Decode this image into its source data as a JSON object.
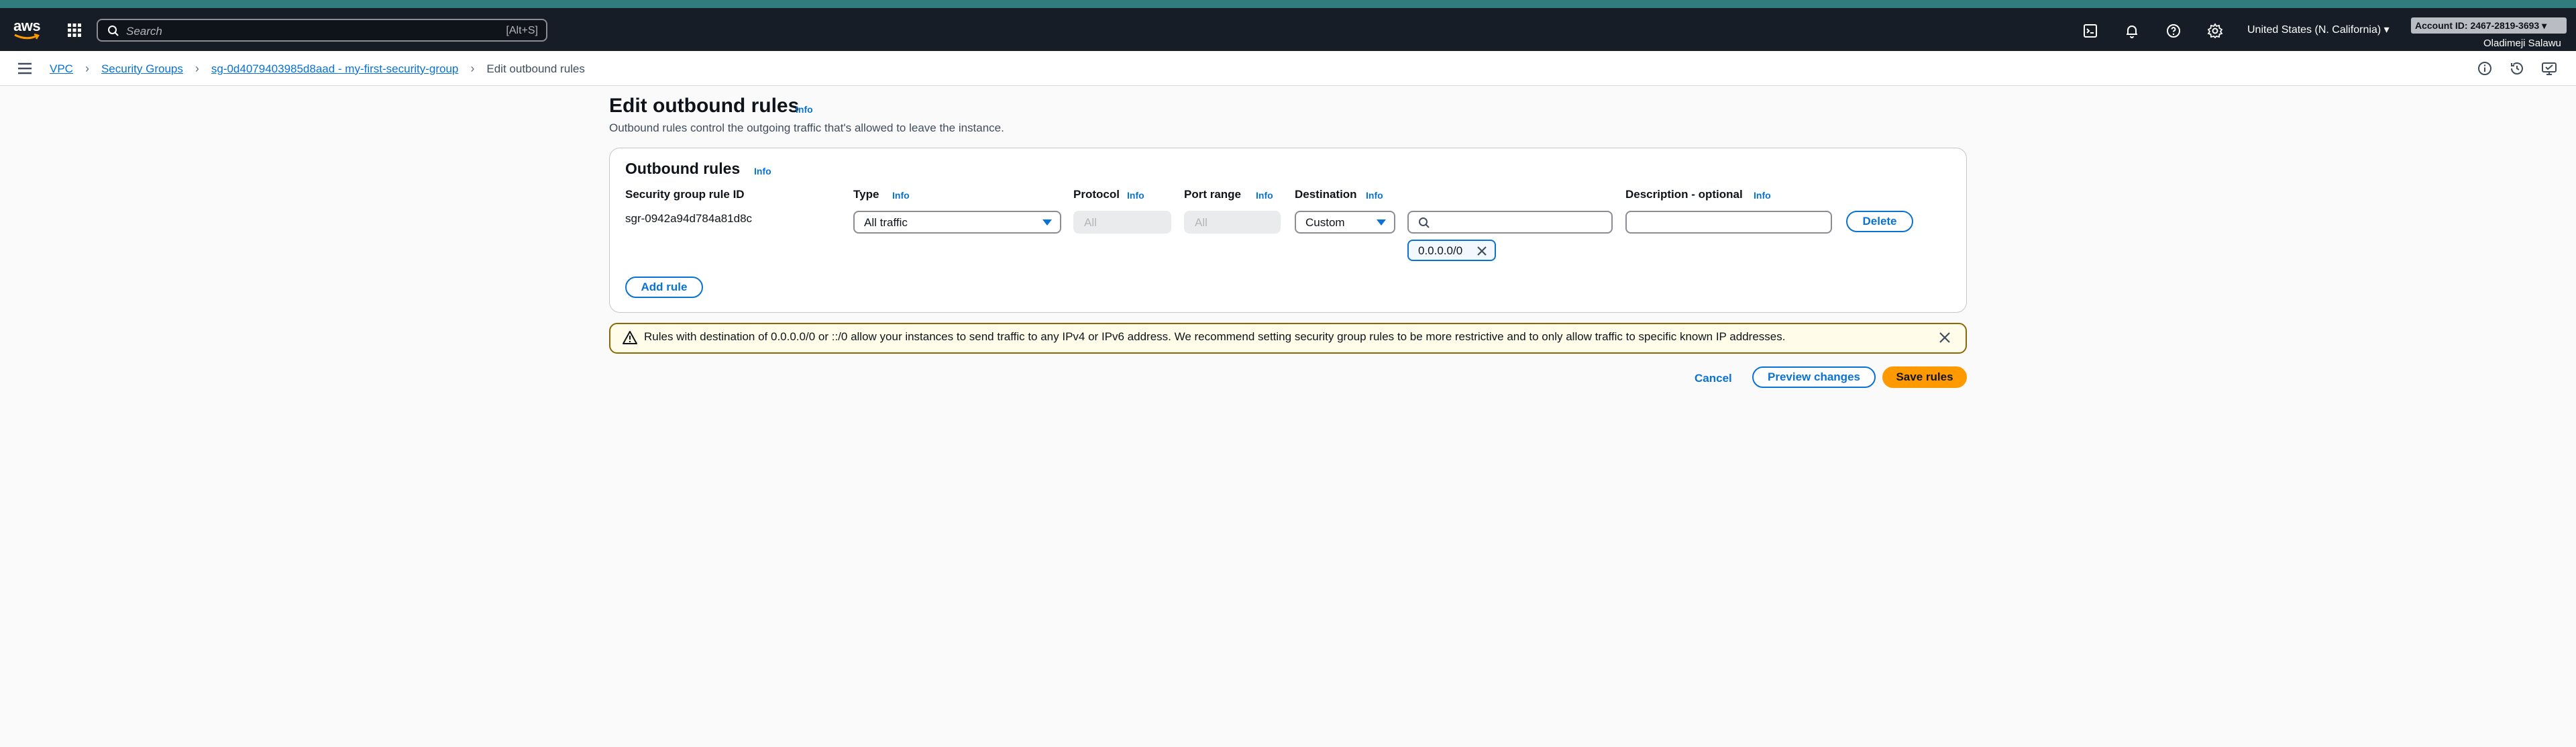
{
  "nav": {
    "search_placeholder": "Search",
    "search_shortcut": "[Alt+S]",
    "region": "United States (N. California) ▾",
    "account_id": "Account ID: 2467-2819-3693 ▾",
    "username": "Oladimeji Salawu"
  },
  "breadcrumb": {
    "items": [
      "VPC",
      "Security Groups",
      "sg-0d4079403985d8aad - my-first-security-group"
    ],
    "current": "Edit outbound rules"
  },
  "page": {
    "title": "Edit outbound rules",
    "info": "Info",
    "description": "Outbound rules control the outgoing traffic that's allowed to leave the instance."
  },
  "rules": {
    "title": "Outbound rules",
    "info": "Info",
    "columns": {
      "rule_id": "Security group rule ID",
      "type": "Type",
      "protocol": "Protocol",
      "port_range": "Port range",
      "destination": "Destination",
      "description": "Description - optional"
    },
    "row": {
      "rule_id": "sgr-0942a94d784a81d8c",
      "type": "All traffic",
      "protocol": "All",
      "port_range": "All",
      "destination": "Custom",
      "destination_token": "0.0.0.0/0",
      "delete": "Delete"
    },
    "add_rule": "Add rule"
  },
  "warning": {
    "text": "Rules with destination of 0.0.0.0/0 or ::/0 allow your instances to send traffic to any IPv4 or IPv6 address. We recommend setting security group rules to be more restrictive and to only allow traffic to specific known IP addresses."
  },
  "actions": {
    "cancel": "Cancel",
    "preview": "Preview changes",
    "save": "Save rules"
  },
  "colors": {
    "accent": "#0972d3",
    "primary": "#ff9900",
    "nav_bg": "#161d26",
    "warning_border": "#8d6605"
  }
}
